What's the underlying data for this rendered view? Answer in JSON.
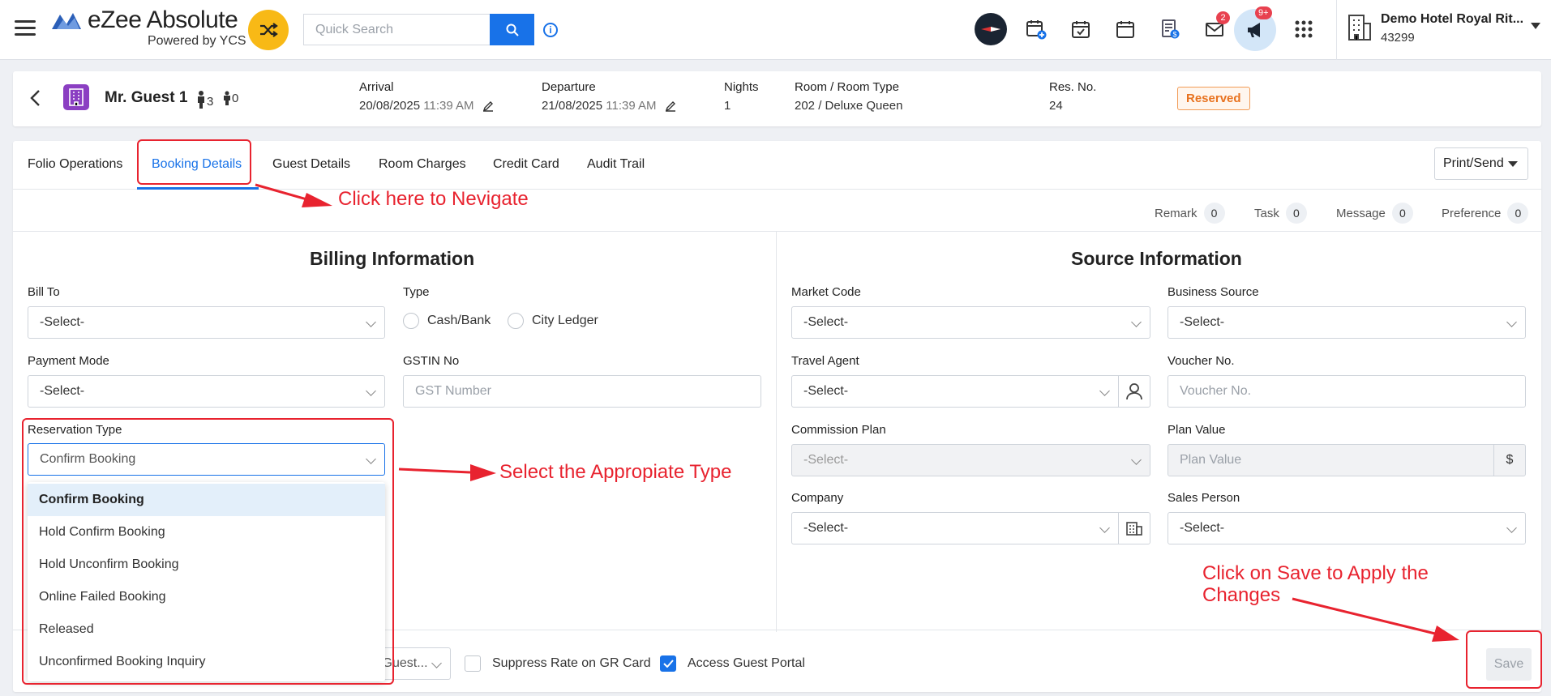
{
  "app": {
    "title": "eZee Absolute",
    "subtitle": "Powered by YCS",
    "search_placeholder": "Quick Search",
    "hotel_name": "Demo Hotel Royal Rit...",
    "hotel_id": "43299",
    "badges": {
      "mail": "2",
      "announcements": "9+"
    }
  },
  "reservation": {
    "guest_name": "Mr. Guest 1",
    "adults": "3",
    "children": "0",
    "arrival_label": "Arrival",
    "arrival_date": "20/08/2025",
    "arrival_time": "11:39 AM",
    "departure_label": "Departure",
    "departure_date": "21/08/2025",
    "departure_time": "11:39 AM",
    "nights_label": "Nights",
    "nights": "1",
    "room_label": "Room / Room Type",
    "room": "202 / Deluxe Queen",
    "resno_label": "Res. No.",
    "resno": "24",
    "status": "Reserved"
  },
  "tabs": [
    "Folio Operations",
    "Booking Details",
    "Guest Details",
    "Room Charges",
    "Credit Card",
    "Audit Trail"
  ],
  "print_send": "Print/Send",
  "counts": [
    {
      "label": "Remark",
      "value": "0"
    },
    {
      "label": "Task",
      "value": "0"
    },
    {
      "label": "Message",
      "value": "0"
    },
    {
      "label": "Preference",
      "value": "0"
    }
  ],
  "billing": {
    "title": "Billing Information",
    "bill_to_label": "Bill To",
    "bill_to_value": "-Select-",
    "type_label": "Type",
    "type_options": [
      "Cash/Bank",
      "City Ledger"
    ],
    "payment_mode_label": "Payment Mode",
    "payment_mode_value": "-Select-",
    "gstin_label": "GSTIN No",
    "gstin_placeholder": "GST Number",
    "res_type_label": "Reservation Type",
    "res_type_value": "Confirm Booking",
    "res_type_options": [
      "Confirm Booking",
      "Hold Confirm Booking",
      "Hold Unconfirm Booking",
      "Online Failed Booking",
      "Released",
      "Unconfirmed Booking Inquiry"
    ]
  },
  "source": {
    "title": "Source Information",
    "market_code_label": "Market Code",
    "market_code_value": "-Select-",
    "business_source_label": "Business Source",
    "business_source_value": "-Select-",
    "travel_agent_label": "Travel Agent",
    "travel_agent_value": "-Select-",
    "voucher_label": "Voucher No.",
    "voucher_placeholder": "Voucher No.",
    "commission_label": "Commission Plan",
    "commission_value": "-Select-",
    "plan_value_label": "Plan Value",
    "plan_value_placeholder": "Plan Value",
    "currency": "$",
    "company_label": "Company",
    "company_value": "-Select-",
    "sales_person_label": "Sales Person",
    "sales_person_value": "-Select-"
  },
  "footer": {
    "email_template": "Thank You email to Guest...",
    "suppress_rate": "Suppress Rate on GR Card",
    "suppress_rate_checked": false,
    "guest_portal": "Access Guest Portal",
    "guest_portal_checked": true,
    "save": "Save"
  },
  "annotations": {
    "navigate": "Click here to Nevigate",
    "select_type": "Select the Appropiate Type",
    "save_line1": "Click on Save to Apply the",
    "save_line2": "Changes"
  },
  "colors": {
    "accent": "#1872e8",
    "annotation": "#e8232f",
    "status": "#e8721f"
  }
}
